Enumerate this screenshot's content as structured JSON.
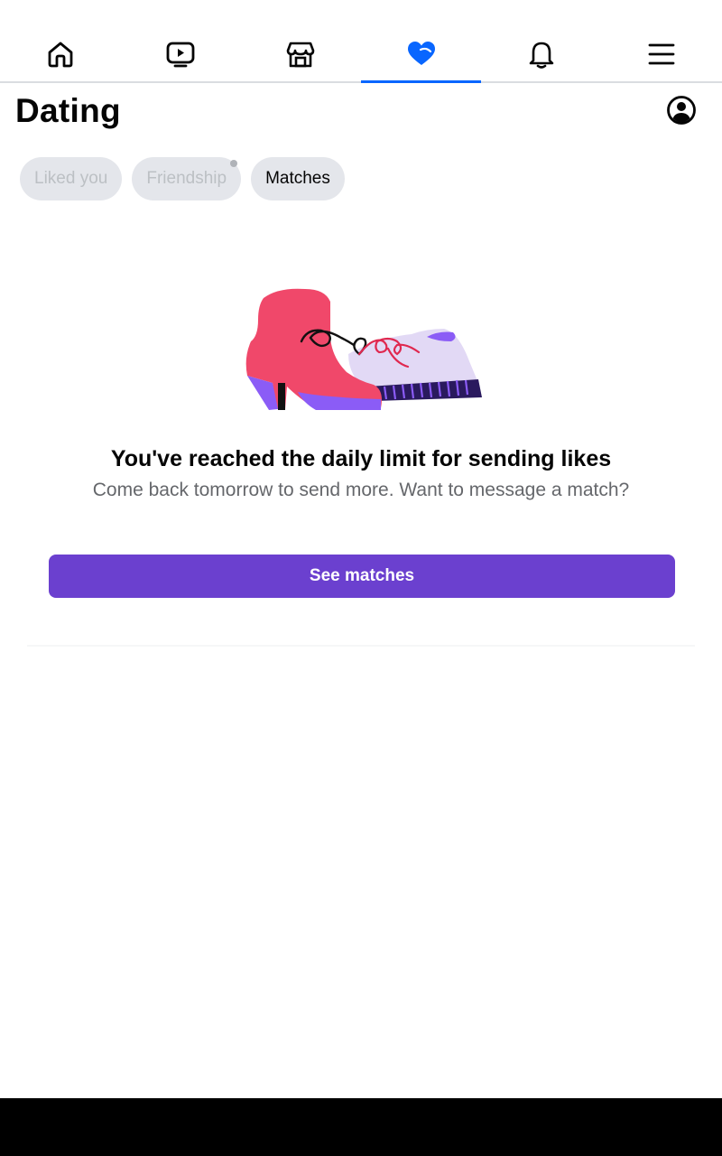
{
  "nav": {
    "tabs": [
      {
        "name": "home",
        "icon": "home-icon",
        "active": false
      },
      {
        "name": "video",
        "icon": "video-icon",
        "active": false
      },
      {
        "name": "marketplace",
        "icon": "marketplace-icon",
        "active": false
      },
      {
        "name": "dating",
        "icon": "heart-icon",
        "active": true
      },
      {
        "name": "notifications",
        "icon": "bell-icon",
        "active": false
      },
      {
        "name": "menu",
        "icon": "menu-icon",
        "active": false
      }
    ],
    "active_color": "#0866ff"
  },
  "header": {
    "title": "Dating",
    "profile_icon": "profile-icon"
  },
  "chips": [
    {
      "label": "Liked you",
      "state": "disabled"
    },
    {
      "label": "Friendship",
      "state": "disabled",
      "has_dot": true
    },
    {
      "label": "Matches",
      "state": "enabled"
    }
  ],
  "empty_state": {
    "illustration": "boot-and-sneaker-illustration",
    "title": "You've reached the daily limit for sending likes",
    "subtitle": "Come back tomorrow to send more. Want to message a match?",
    "button_label": "See matches",
    "button_color": "#6b40cf"
  }
}
